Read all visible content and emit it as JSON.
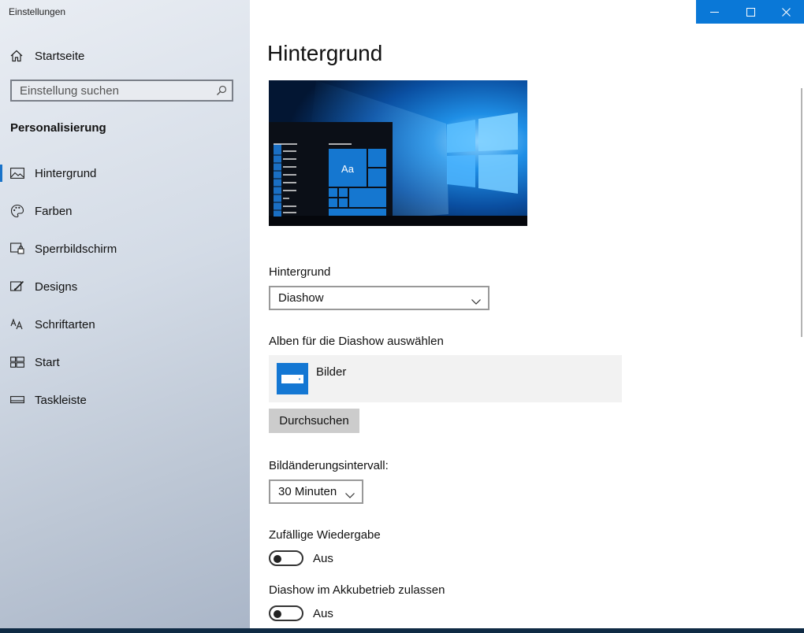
{
  "window": {
    "title": "Einstellungen"
  },
  "sidebar": {
    "home_label": "Startseite",
    "search_placeholder": "Einstellung suchen",
    "section_title": "Personalisierung",
    "items": [
      {
        "label": "Hintergrund",
        "icon": "picture-icon",
        "active": true
      },
      {
        "label": "Farben",
        "icon": "palette-icon",
        "active": false
      },
      {
        "label": "Sperrbildschirm",
        "icon": "lockscreen-icon",
        "active": false
      },
      {
        "label": "Designs",
        "icon": "brush-icon",
        "active": false
      },
      {
        "label": "Schriftarten",
        "icon": "font-icon",
        "active": false
      },
      {
        "label": "Start",
        "icon": "start-icon",
        "active": false
      },
      {
        "label": "Taskleiste",
        "icon": "taskbar-icon",
        "active": false
      }
    ]
  },
  "main": {
    "title": "Hintergrund",
    "preview": {
      "tile_text": "Aa"
    },
    "background": {
      "label": "Hintergrund",
      "value": "Diashow"
    },
    "albums": {
      "label": "Alben für die Diashow auswählen",
      "album_name": "Bilder"
    },
    "browse_button": "Durchsuchen",
    "interval": {
      "label": "Bildänderungsintervall:",
      "value": "30 Minuten"
    },
    "shuffle": {
      "label": "Zufällige Wiedergabe",
      "state": "Aus"
    },
    "battery": {
      "label": "Diashow im Akkubetrieb zulassen",
      "state": "Aus"
    }
  },
  "colors": {
    "accent": "#0a78d7",
    "title_bar_button": "#0a78d7"
  }
}
